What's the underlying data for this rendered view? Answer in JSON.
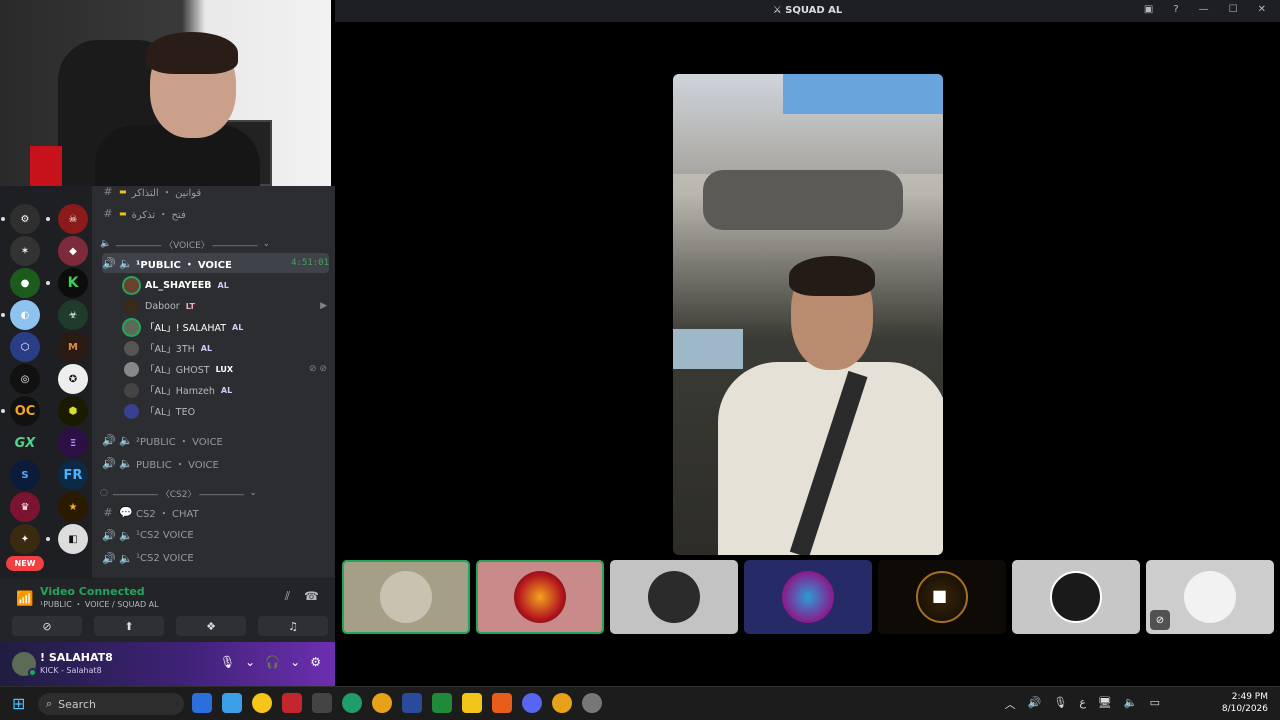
{
  "window": {
    "title": "SQUAD AL"
  },
  "channels": {
    "top": [
      {
        "name": "قوانين ・ التذاكر"
      },
      {
        "name": "فتح ・ تذكرة"
      }
    ],
    "voice_category": "――――― 〈VOICE〉 ―――――",
    "active_channel": {
      "name": "¹PUBLIC ・ VOICE",
      "timer": "4:51:01"
    },
    "users": [
      {
        "name": "AL_SHAYEEB",
        "tag": "AL",
        "color": "#6b4030"
      },
      {
        "name": "Daboor",
        "tag": "LT",
        "color": "#3a2a1a"
      },
      {
        "name": "「AL」! SALAHAT",
        "tag": "AL",
        "color": "#5b6b55"
      },
      {
        "name": "「AL」3TH",
        "tag": "AL",
        "color": "#555"
      },
      {
        "name": "「AL」GHOST",
        "tag": "LUX",
        "color": "#888"
      },
      {
        "name": "「AL」Hamzeh",
        "tag": "AL",
        "color": "#444"
      },
      {
        "name": "「AL」TEO",
        "tag": "",
        "color": "#3b3f8f"
      }
    ],
    "more_voice": [
      {
        "name": "²PUBLIC ・ VOICE"
      },
      {
        "name": "PUBLIC ・ VOICE"
      }
    ],
    "cs2_category": "――――― 〈CS2〉 ―――――",
    "cs2": [
      {
        "name": "CS2 ・ CHAT"
      },
      {
        "name": "¹CS2 VOICE"
      },
      {
        "name": "¹CS2 VOICE"
      }
    ]
  },
  "servers": {
    "new_badge": "NEW",
    "labels": [
      "GX",
      "OC",
      "FR",
      "M"
    ]
  },
  "voice_panel": {
    "status": "Video Connected",
    "channel": "¹PUBLIC ・ VOICE / SQUAD AL"
  },
  "user_panel": {
    "name": "! SALAHAT8",
    "status": "KICK - Salahat8"
  },
  "taskbar": {
    "search": "Search",
    "time": "2:49 PM",
    "date": "8/10/2026",
    "lang": "ع"
  },
  "colors": {
    "accent_green": "#23a55a",
    "bg_dark": "#1e1f22",
    "panel": "#2b2d31"
  }
}
